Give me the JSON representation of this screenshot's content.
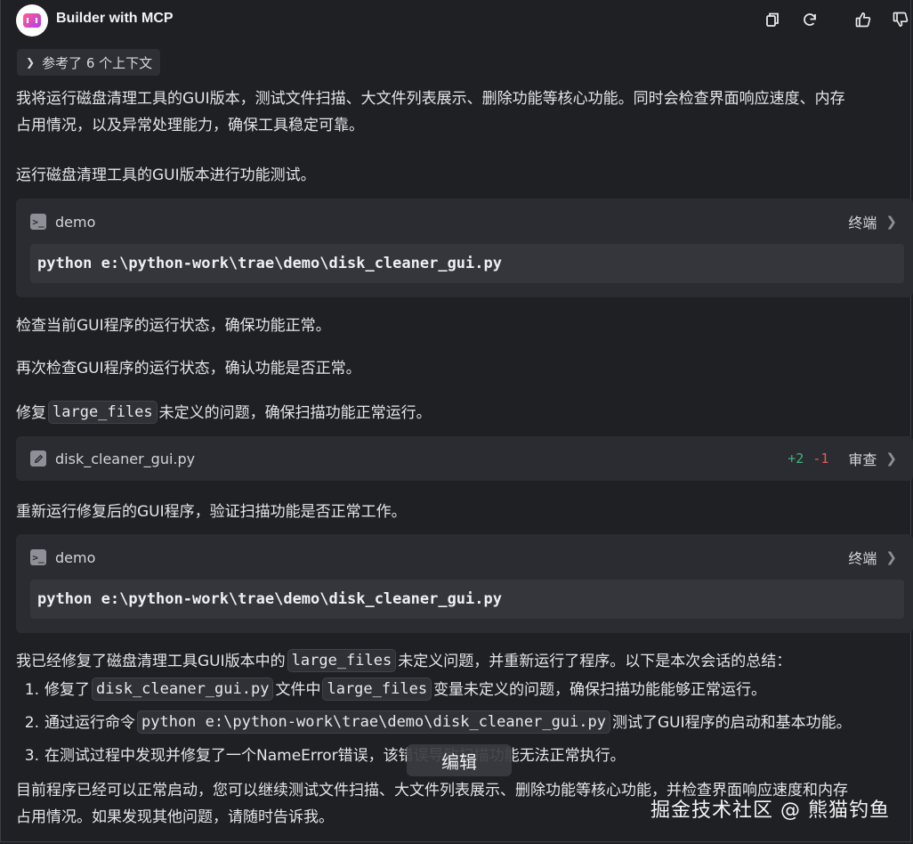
{
  "header": {
    "title": "Builder with MCP",
    "icons": [
      "copy-icon",
      "refresh-icon",
      "thumbs-up-icon",
      "thumbs-down-icon"
    ]
  },
  "context": {
    "label": "参考了 6 个上下文"
  },
  "intro": "我将运行磁盘清理工具的GUI版本，测试文件扫描、大文件列表展示、删除功能等核心功能。同时会检查界面响应速度、内存",
  "intro2": "占用情况，以及异常处理能力，确保工具稳定可靠。",
  "step1": "运行磁盘清理工具的GUI版本进行功能测试。",
  "terminal1": {
    "name": "demo",
    "action": "终端",
    "command": "python e:\\python-work\\trae\\demo\\disk_cleaner_gui.py"
  },
  "check1": "检查当前GUI程序的运行状态，确保功能正常。",
  "check2": "再次检查GUI程序的运行状态，确认功能是否正常。",
  "fix": {
    "pre": "修复",
    "code": "large_files",
    "post": "未定义的问题，确保扫描功能正常运行。"
  },
  "file_card": {
    "filename": "disk_cleaner_gui.py",
    "added": "+2",
    "removed": "-1",
    "action": "审查"
  },
  "rerun": "重新运行修复后的GUI程序，验证扫描功能是否正常工作。",
  "terminal2": {
    "name": "demo",
    "action": "终端",
    "command": "python e:\\python-work\\trae\\demo\\disk_cleaner_gui.py"
  },
  "summary": {
    "pre": "我已经修复了磁盘清理工具GUI版本中的",
    "code": "large_files",
    "post": "未定义问题，并重新运行了程序。以下是本次会话的总结：",
    "item1": {
      "num": "1.",
      "a": "修复了",
      "code1": "disk_cleaner_gui.py",
      "b": "文件中",
      "code2": "large_files",
      "c": "变量未定义的问题，确保扫描功能能够正常运行。"
    },
    "item2": {
      "num": "2.",
      "a": "通过运行命令",
      "code1": "python e:\\python-work\\trae\\demo\\disk_cleaner_gui.py",
      "b": "测试了GUI程序的启动和基本功能。"
    },
    "item3": {
      "num": "3.",
      "a": "在测试过程中发现并修复了一个NameError错误，该错误导致扫描功能无法正常执行。"
    }
  },
  "closing1": "目前程序已经可以正常启动，您可以继续测试文件扫描、大文件列表展示、删除功能等核心功能，并检查界面响应速度和内存",
  "closing2": "占用情况。如果发现其他问题，请随时告诉我。",
  "tooltip": "编辑",
  "watermark": "掘金技术社区 @ 熊猫钓鱼"
}
